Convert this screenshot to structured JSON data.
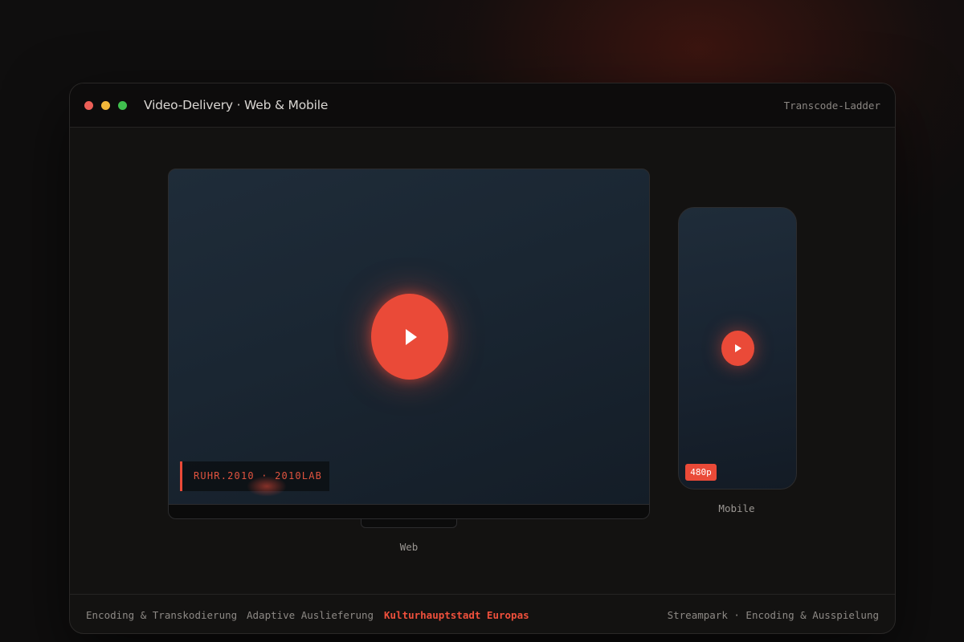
{
  "window": {
    "title": "Video-Delivery · Web & Mobile",
    "header_right": "Transcode-Ladder",
    "controls": {
      "close_color": "#ec5f57",
      "minimize_color": "#f2b83a",
      "maximize_color": "#3fbf4e"
    }
  },
  "web_player": {
    "device_label": "Web",
    "overlay_tag": "RUHR.2010 · 2010LAB",
    "play_icon": "play-icon"
  },
  "mobile_player": {
    "device_label": "Mobile",
    "resolution_badge": "480p",
    "play_icon": "play-icon"
  },
  "footer": {
    "tabs": [
      {
        "label": "Encoding & Transkodierung",
        "active": false
      },
      {
        "label": "Adaptive Auslieferung",
        "active": false
      },
      {
        "label": "Kulturhauptstadt Europas",
        "active": true
      }
    ],
    "right_text": "Streampark · Encoding & Ausspielung"
  },
  "colors": {
    "accent": "#ea4a38",
    "background": "#0f0e0e",
    "window": "#131211"
  }
}
